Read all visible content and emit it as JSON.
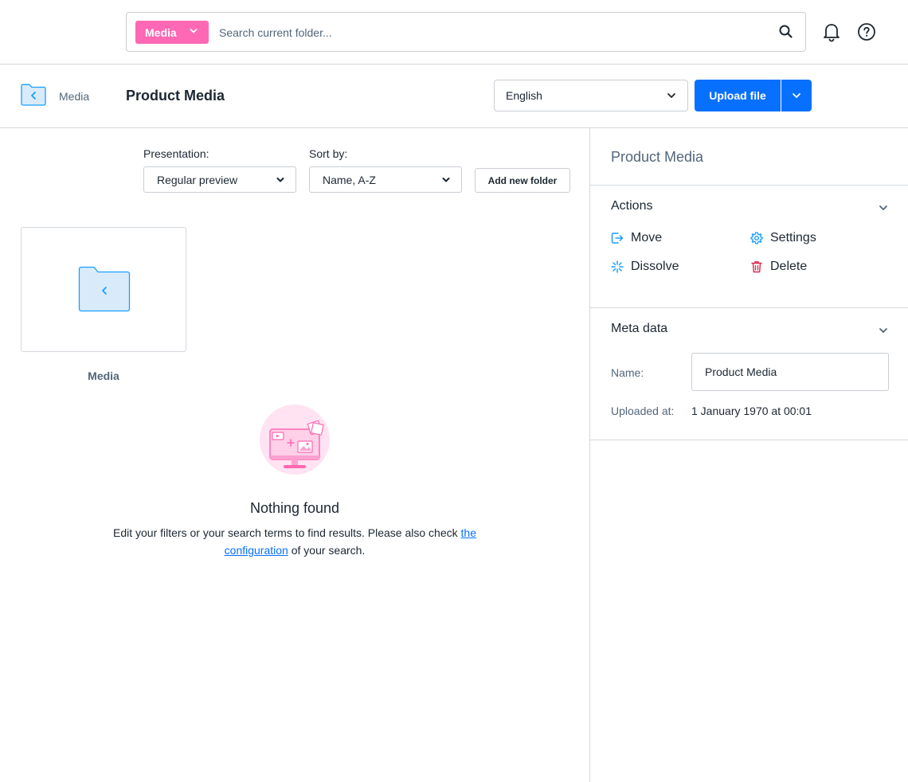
{
  "search": {
    "type_label": "Media",
    "placeholder": "Search current folder..."
  },
  "topbar": {
    "notifications_icon": "bell-icon",
    "help_icon": "help-icon"
  },
  "header": {
    "breadcrumb_parent": "Media",
    "title": "Product Media",
    "language": "English",
    "upload_label": "Upload file"
  },
  "toolbar": {
    "presentation_label": "Presentation:",
    "presentation_value": "Regular preview",
    "sort_label": "Sort by:",
    "sort_value": "Name, A-Z",
    "add_folder_label": "Add new folder"
  },
  "folders": [
    {
      "name": "Media"
    }
  ],
  "empty_state": {
    "title": "Nothing found",
    "text_before": "Edit your filters or your search terms to find results. Please also check ",
    "link_text": "the configuration",
    "text_after": " of your search."
  },
  "sidebar": {
    "title": "Product Media",
    "actions_title": "Actions",
    "actions": {
      "move": "Move",
      "settings": "Settings",
      "dissolve": "Dissolve",
      "delete": "Delete"
    },
    "meta_title": "Meta data",
    "name_label": "Name:",
    "name_value": "Product Media",
    "uploaded_label": "Uploaded at:",
    "uploaded_value": "1 January 1970 at 00:01"
  },
  "colors": {
    "accent": "#0870ff",
    "media_badge": "#ff68b4",
    "folder": "#d9ebfa",
    "danger": "#de294c"
  }
}
